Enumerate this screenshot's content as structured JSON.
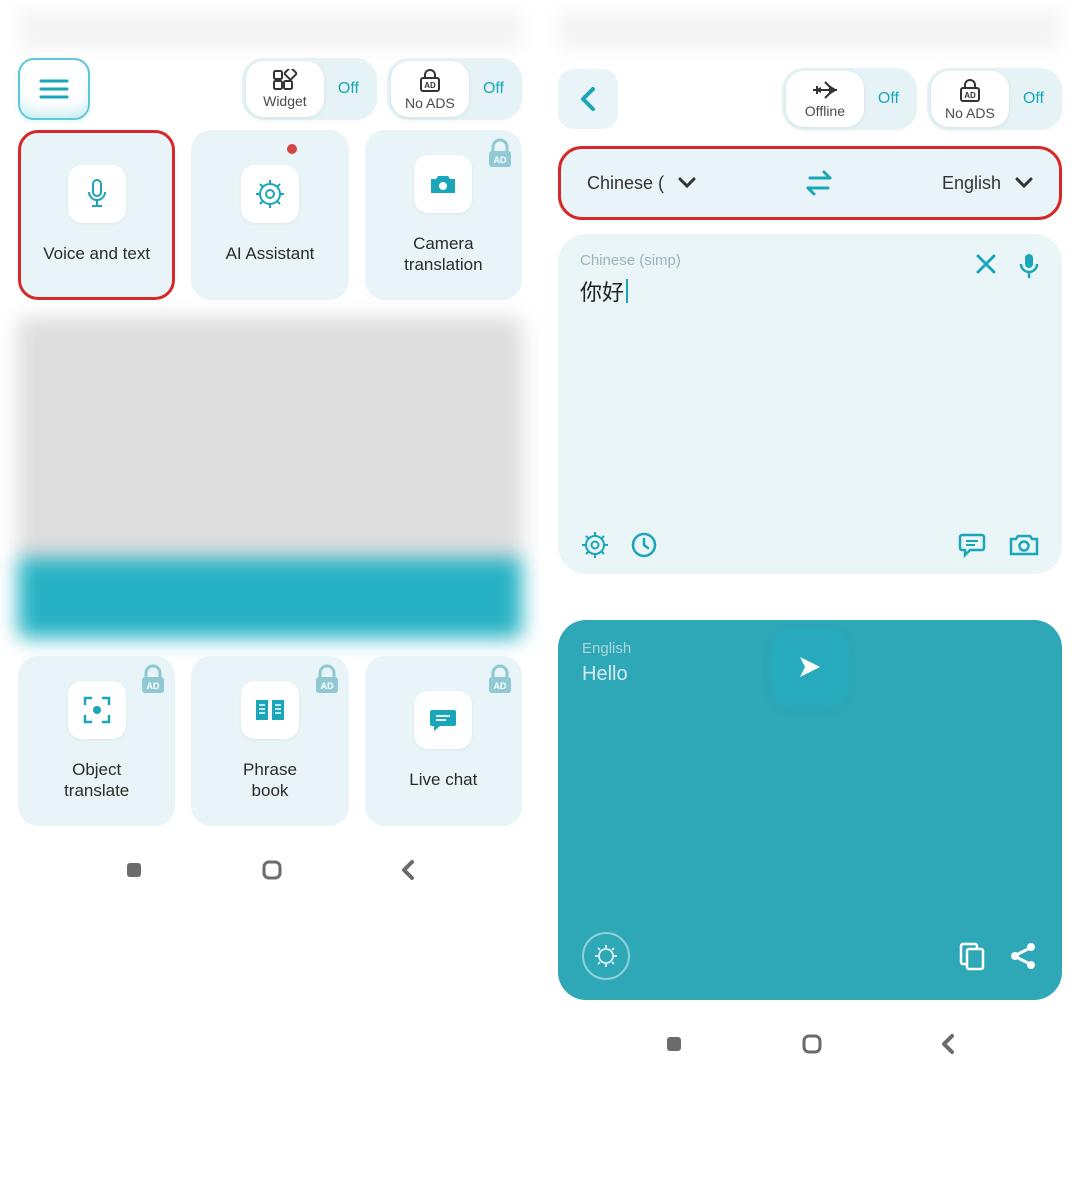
{
  "screen1": {
    "toggles": {
      "widget": {
        "label": "Widget",
        "state": "Off"
      },
      "noads": {
        "label": "No ADS",
        "state": "Off"
      }
    },
    "tiles_top": [
      {
        "label": "Voice and text"
      },
      {
        "label": "AI Assistant"
      },
      {
        "label": "Camera\ntranslation"
      }
    ],
    "tiles_bottom": [
      {
        "label": "Object\ntranslate"
      },
      {
        "label": "Phrase\nbook"
      },
      {
        "label": "Live chat"
      }
    ]
  },
  "screen2": {
    "toggles": {
      "offline": {
        "label": "Offline",
        "state": "Off"
      },
      "noads": {
        "label": "No ADS",
        "state": "Off"
      }
    },
    "lang_from": "Chinese (",
    "lang_to": "English",
    "input_lang_label": "Chinese (simp)",
    "input_text": "你好",
    "output_lang_label": "English",
    "output_text": "Hello"
  }
}
